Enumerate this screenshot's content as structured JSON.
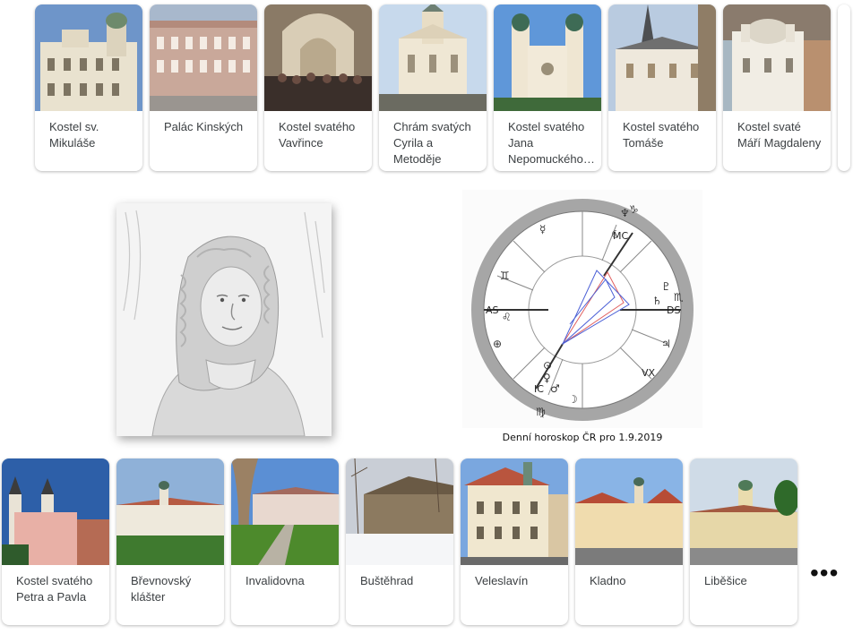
{
  "top_cards": [
    {
      "label": "Kostel sv. Mikuláše",
      "sky": "#6e95c9"
    },
    {
      "label": "Palác Kinských",
      "sky": "#a8b8cc"
    },
    {
      "label": "Kostel svatého Vavřince",
      "sky": "#8a7a66"
    },
    {
      "label": "Chrám svatých Cyrila a Metoděje",
      "sky": "#c7d9ec"
    },
    {
      "label": "Kostel svatého Jana Nepomuckého…",
      "sky": "#5f97d9"
    },
    {
      "label": "Kostel svatého Tomáše",
      "sky": "#b9cbe0"
    },
    {
      "label": "Kostel svaté Máří Magdaleny",
      "sky": "#a7b7c2"
    }
  ],
  "bottom_cards": [
    {
      "label": "Kostel svatého Petra a Pavla",
      "sky": "#2d5fa8"
    },
    {
      "label": "Břevnovský klášter",
      "sky": "#8fb1d8"
    },
    {
      "label": "Invalidovna",
      "sky": "#5b8fd4"
    },
    {
      "label": "Buštěhrad",
      "sky": "#c9ced6"
    },
    {
      "label": "Veleslavín",
      "sky": "#7aa7df"
    },
    {
      "label": "Kladno",
      "sky": "#89b4e6"
    },
    {
      "label": "Liběšice",
      "sky": "#cfdbe7"
    }
  ],
  "horoscope": {
    "caption": "Denní horoskop ČR pro 1.9.2019",
    "axis_labels": {
      "mc": "MC",
      "ds": "DS",
      "as": "AS",
      "ic": "IC",
      "vx": "VX"
    }
  },
  "more_glyph": "•••"
}
